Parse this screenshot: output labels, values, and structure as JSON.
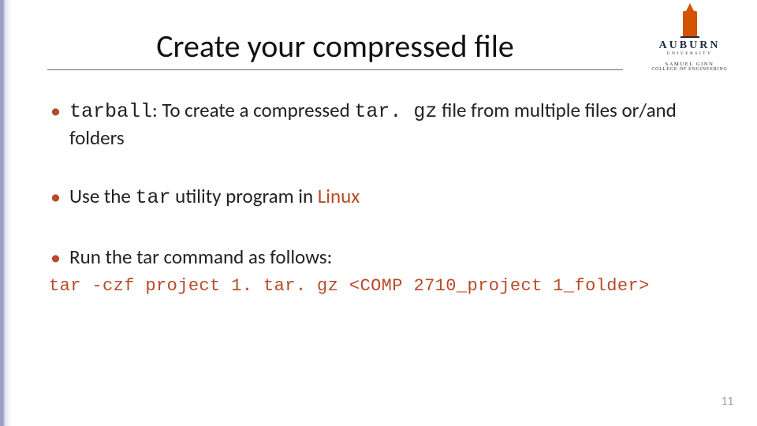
{
  "logo": {
    "name": "AUBURN",
    "univ": "UNIVERSITY",
    "dept1": "SAMUEL GINN",
    "dept2": "COLLEGE OF ENGINEERING"
  },
  "title": "Create your compressed file",
  "bullets": {
    "b1": {
      "code1": "tarball",
      "mid1": ": To create a compressed ",
      "code2": "tar. gz",
      "tail": " file from multiple files or/and folders"
    },
    "b2": {
      "lead": "Use the ",
      "code": "tar",
      "mid": " utility program in ",
      "linux": "Linux"
    },
    "b3": {
      "text": "Run the tar command as follows:"
    }
  },
  "command": "tar -czf project 1. tar. gz <COMP 2710_project 1_folder>",
  "page": "11"
}
